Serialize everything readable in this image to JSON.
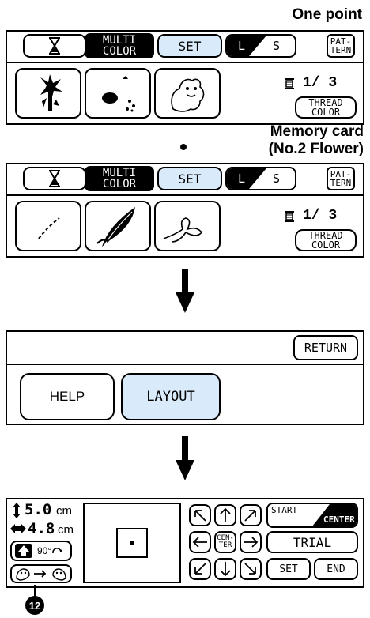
{
  "section1": {
    "label": "One point",
    "multi_line1": "MULTI",
    "multi_line2": "COLOR",
    "set_label": "SET",
    "l_label": "L",
    "s_label": "S",
    "pattern_line1": "PAT-",
    "pattern_line2": "TERN",
    "thread_count": "1/ 3",
    "thread_color_line1": "THREAD",
    "thread_color_line2": "COLOR"
  },
  "section2": {
    "label_line1": "Memory card",
    "label_line2": "(No.2 Flower)",
    "multi_line1": "MULTI",
    "multi_line2": "COLOR",
    "set_label": "SET",
    "l_label": "L",
    "s_label": "S",
    "pattern_line1": "PAT-",
    "pattern_line2": "TERN",
    "thread_count": "1/ 3",
    "thread_color_line1": "THREAD",
    "thread_color_line2": "COLOR"
  },
  "section3": {
    "return_label": "RETURN",
    "help_label": "HELP",
    "layout_label": "LAYOUT"
  },
  "section4": {
    "height_value": "5.0",
    "height_unit": "cm",
    "width_value": "4.8",
    "width_unit": "cm",
    "rotate_label": "90°",
    "start_label": "START",
    "center_label": "CENTER",
    "center_btn_line1": "CEN-",
    "center_btn_line2": "TER",
    "trial_label": "TRIAL",
    "set_label": "SET",
    "end_label": "END",
    "callout_number": "12"
  },
  "colors": {
    "accent": "#d9ebfa",
    "ink": "#000000"
  }
}
